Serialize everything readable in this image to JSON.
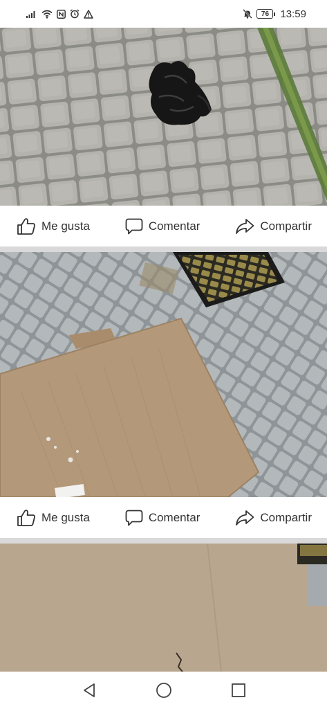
{
  "status_bar": {
    "icons_left": [
      "signal-icon",
      "wifi-icon",
      "nfc-icon",
      "alarm-icon",
      "warning-icon"
    ],
    "icons_right": [
      "mute-icon",
      "battery-icon"
    ],
    "battery_level": "76",
    "time": "13:59"
  },
  "posts": [
    {
      "image": "Bolsa de basura negra sobre adoquines",
      "actions": {
        "like": "Me gusta",
        "comment": "Comentar",
        "share": "Compartir"
      }
    },
    {
      "image": "Cartón en la vereda junto a un felpudo",
      "actions": {
        "like": "Me gusta",
        "comment": "Comentar",
        "share": "Compartir"
      }
    },
    {
      "image": "Cartón en la vereda (vista cercana)"
    }
  ],
  "nav_bar": {
    "icons": [
      "back-icon",
      "home-icon",
      "recents-icon"
    ]
  },
  "colors": {
    "text": "#333333",
    "divider": "#d9d9d9",
    "background": "#ffffff"
  }
}
